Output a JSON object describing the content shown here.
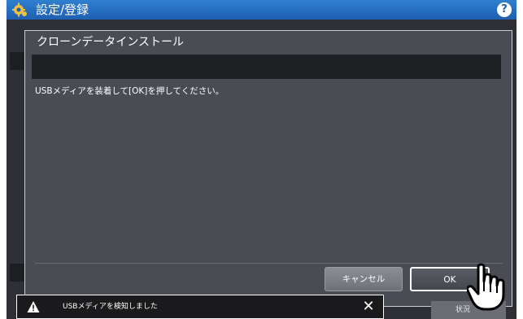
{
  "header": {
    "title": "設定/登録",
    "help_label": "?"
  },
  "dialog": {
    "title": "クローンデータインストール",
    "message": "USBメディアを装着して[OK]を押してください。",
    "cancel_label": "キャンセル",
    "ok_label": "OK"
  },
  "notification": {
    "text": "USBメディアを検知しました",
    "close_label": "✕"
  },
  "status_button": {
    "label": "状況"
  },
  "icons": {
    "header": "gear-icon",
    "notification": "warning-icon",
    "pointer": "hand-pointer-icon"
  },
  "colors": {
    "header_blue": "#1f5fb0",
    "dialog_bg": "#4a4c54",
    "ok_border": "#ffffff"
  }
}
